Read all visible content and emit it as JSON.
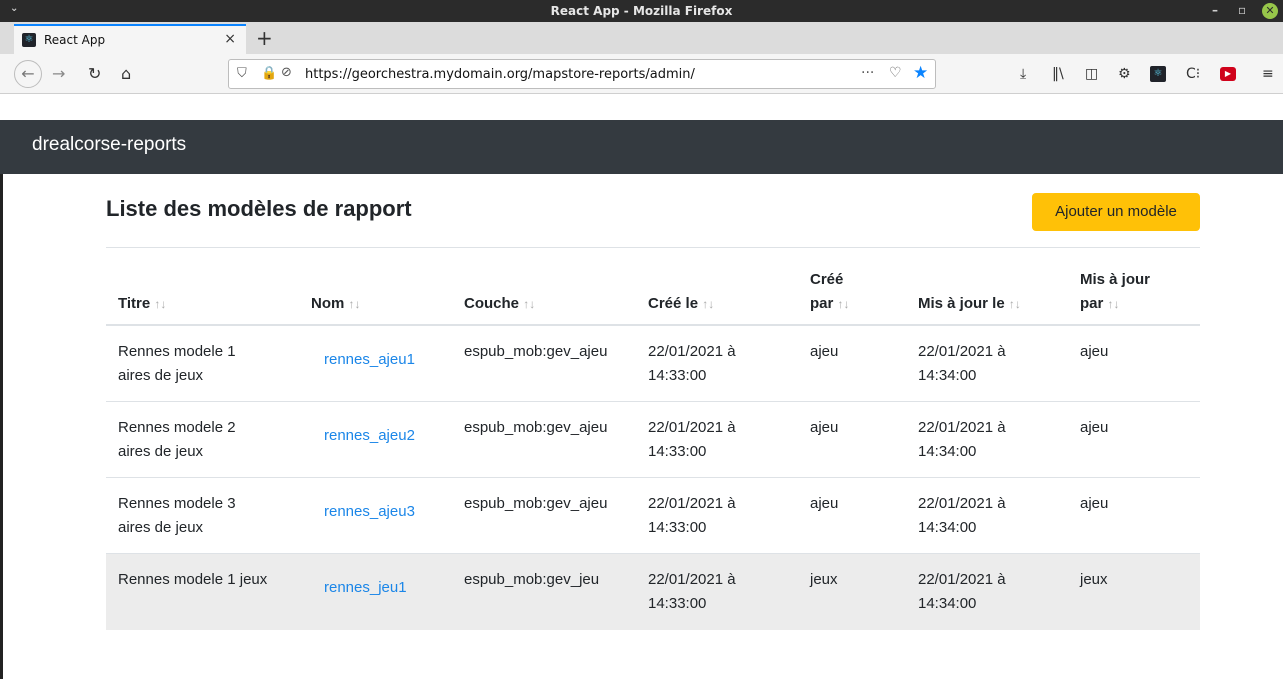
{
  "window": {
    "title": "React App - Mozilla Firefox",
    "controls": {
      "minimize": "–",
      "maximize": "▫",
      "close": "✕"
    }
  },
  "browser": {
    "tab": {
      "title": "React App",
      "close": "×"
    },
    "new_tab": "+",
    "url": "https://georchestra.mydomain.org/mapstore-reports/admin/",
    "url_more": "···"
  },
  "app": {
    "brand": "drealcorse-reports",
    "page_title": "Liste des modèles de rapport",
    "add_button": "Ajouter un modèle",
    "sort_glyph": "↑↓",
    "columns": [
      {
        "line1": "",
        "line2": "Titre"
      },
      {
        "line1": "",
        "line2": "Nom"
      },
      {
        "line1": "",
        "line2": "Couche"
      },
      {
        "line1": "",
        "line2": "Créé le"
      },
      {
        "line1": "Créé",
        "line2": "par"
      },
      {
        "line1": "",
        "line2": "Mis à jour le"
      },
      {
        "line1": "Mis à jour",
        "line2": "par"
      }
    ],
    "rows": [
      {
        "titre_1": "Rennes modele 1",
        "titre_2": "aires de jeux",
        "nom": "rennes_ajeu1",
        "couche": "espub_mob:gev_ajeu",
        "cree_le_1": "22/01/2021 à",
        "cree_le_2": "14:33:00",
        "cree_par": "ajeu",
        "maj_le_1": "22/01/2021 à",
        "maj_le_2": "14:34:00",
        "maj_par": "ajeu"
      },
      {
        "titre_1": "Rennes modele 2",
        "titre_2": "aires de jeux",
        "nom": "rennes_ajeu2",
        "couche": "espub_mob:gev_ajeu",
        "cree_le_1": "22/01/2021 à",
        "cree_le_2": "14:33:00",
        "cree_par": "ajeu",
        "maj_le_1": "22/01/2021 à",
        "maj_le_2": "14:34:00",
        "maj_par": "ajeu"
      },
      {
        "titre_1": "Rennes modele 3",
        "titre_2": "aires de jeux",
        "nom": "rennes_ajeu3",
        "couche": "espub_mob:gev_ajeu",
        "cree_le_1": "22/01/2021 à",
        "cree_le_2": "14:33:00",
        "cree_par": "ajeu",
        "maj_le_1": "22/01/2021 à",
        "maj_le_2": "14:34:00",
        "maj_par": "ajeu"
      },
      {
        "titre_1": "Rennes modele 1 jeux",
        "titre_2": "",
        "nom": "rennes_jeu1",
        "couche": "espub_mob:gev_jeu",
        "cree_le_1": "22/01/2021 à",
        "cree_le_2": "14:33:00",
        "cree_par": "jeux",
        "maj_le_1": "22/01/2021 à",
        "maj_le_2": "14:34:00",
        "maj_par": "jeux"
      }
    ]
  }
}
